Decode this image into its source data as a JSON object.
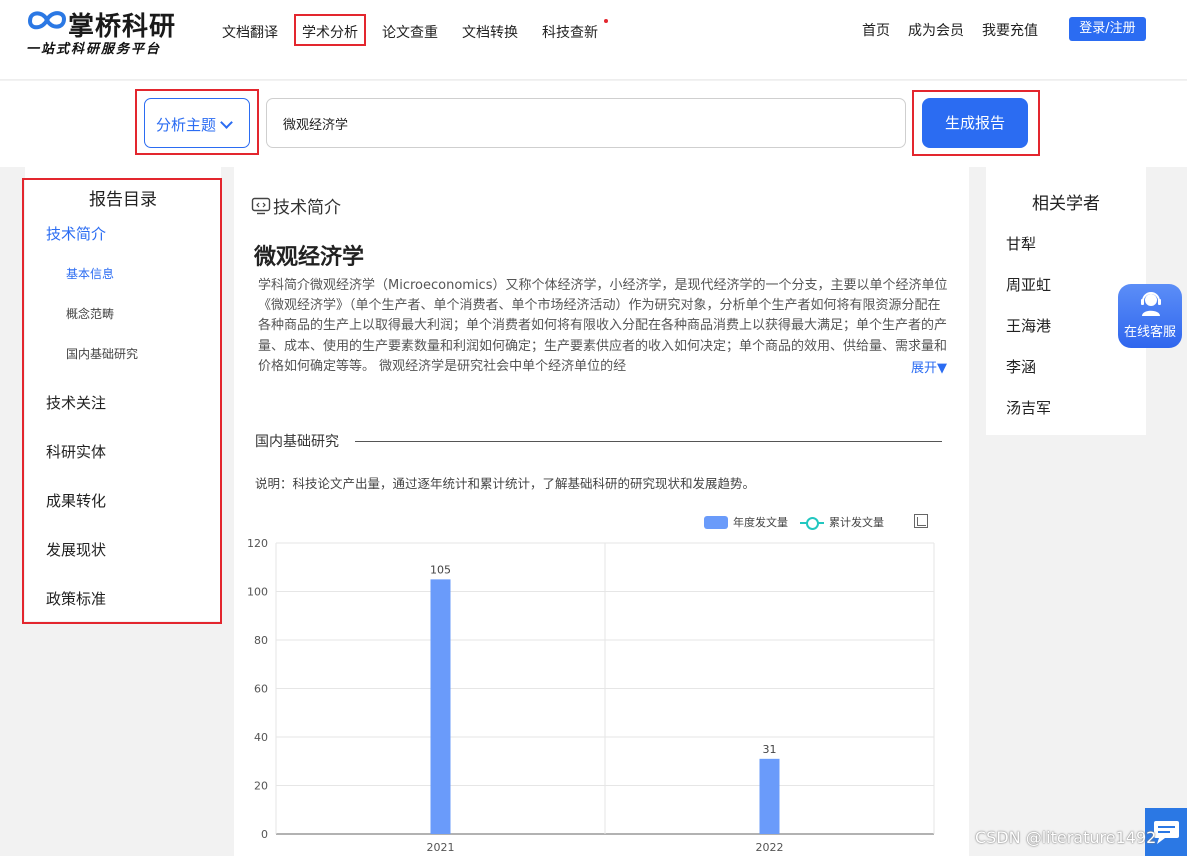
{
  "header": {
    "logo_name": "掌桥科研",
    "logo_slogan": "一站式科研服务平台",
    "nav": [
      {
        "label": "文档翻译",
        "active": false,
        "dot": false
      },
      {
        "label": "学术分析",
        "active": true,
        "dot": false
      },
      {
        "label": "论文查重",
        "active": false,
        "dot": false
      },
      {
        "label": "文档转换",
        "active": false,
        "dot": false
      },
      {
        "label": "科技查新",
        "active": false,
        "dot": true
      }
    ],
    "home": "首页",
    "member": "成为会员",
    "recharge": "我要充值",
    "login": "登录/注册"
  },
  "search": {
    "topic_label": "分析主题",
    "query": "微观经济学",
    "generate_label": "生成报告"
  },
  "toc": {
    "title": "报告目录",
    "items": [
      {
        "label": "技术简介",
        "active": true
      },
      {
        "label": "基本信息",
        "sub": true,
        "active": true
      },
      {
        "label": "概念范畴",
        "sub": true
      },
      {
        "label": "国内基础研究",
        "sub": true
      },
      {
        "label": "技术关注"
      },
      {
        "label": "科研实体"
      },
      {
        "label": "成果转化"
      },
      {
        "label": "发展现状"
      },
      {
        "label": "政策标准"
      }
    ]
  },
  "main": {
    "section_title": "技术简介",
    "subject": "微观经济学",
    "description": "学科简介微观经济学（Microeconomics）又称个体经济学，小经济学，是现代经济学的一个分支，主要以单个经济单位 《微观经济学》（单个生产者、单个消费者、单个市场经济活动）作为研究对象，分析单个生产者如何将有限资源分配在各种商品的生产上以取得最大利润；单个消费者如何将有限收入分配在各种商品消费上以获得最大满足；单个生产者的产量、成本、使用的生产要素数量和利润如何确定；生产要素供应者的收入如何决定；单个商品的效用、供给量、需求量和价格如何确定等等。 微观经济学是研究社会中单个经济单位的经",
    "expand_label": "展开▼",
    "research_heading": "国内基础研究",
    "research_desc": "说明：科技论文产出量，通过逐年统计和累计统计，了解基础科研的研究现状和发展趋势。",
    "legend_bar": "年度发文量",
    "legend_line": "累计发文量"
  },
  "chart_data": {
    "type": "bar",
    "categories": [
      "2021",
      "2022"
    ],
    "series": [
      {
        "name": "年度发文量",
        "values": [
          105,
          31
        ],
        "color": "#6a9bfa"
      }
    ],
    "ylim": [
      0,
      120
    ],
    "yticks": [
      0,
      20,
      40,
      60,
      80,
      100,
      120
    ],
    "data_labels": true,
    "grid": true
  },
  "scholars": {
    "title": "相关学者",
    "names": [
      "甘犁",
      "周亚虹",
      "王海港",
      "李涵",
      "汤吉军"
    ]
  },
  "float_service": "在线客服",
  "watermark": "CSDN @literature1492",
  "colors": {
    "accent": "#2b6cf2",
    "highlight": "#e3262e",
    "bar": "#6a9bfa",
    "line": "#22c7c0"
  }
}
